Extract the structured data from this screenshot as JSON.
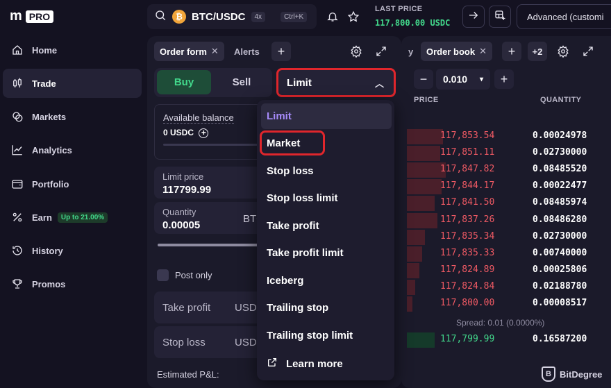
{
  "brand": {
    "logo": "m",
    "badge": "PRO"
  },
  "sidebar": {
    "items": [
      {
        "label": "Home",
        "icon": "home-icon"
      },
      {
        "label": "Trade",
        "icon": "trade-icon",
        "active": true
      },
      {
        "label": "Markets",
        "icon": "markets-icon"
      },
      {
        "label": "Analytics",
        "icon": "analytics-icon"
      },
      {
        "label": "Portfolio",
        "icon": "portfolio-icon"
      },
      {
        "label": "Earn",
        "icon": "percent-icon",
        "badge": "Up to 21.00%"
      },
      {
        "label": "History",
        "icon": "history-icon"
      },
      {
        "label": "Promos",
        "icon": "trophy-icon"
      }
    ]
  },
  "topbar": {
    "coin_symbol": "₿",
    "pair": "BTC/USDC",
    "leverage": "4x",
    "shortcut": "Ctrl+K",
    "last_price_label": "LAST PRICE",
    "last_price": "117,800.00 USDC",
    "layout": "Advanced (customi"
  },
  "order_form": {
    "tabs": [
      "Order form",
      "Alerts"
    ],
    "buy_label": "Buy",
    "sell_label": "Sell",
    "order_type": "Limit",
    "available_balance_label": "Available balance",
    "available_balance_value": "0 USDC",
    "limit_price_label": "Limit price",
    "limit_price_value": "117799.99",
    "quantity_label": "Quantity",
    "quantity_value": "0.00005",
    "quantity_unit": "BTC",
    "post_only_label": "Post only",
    "take_profit_label": "Take profit",
    "take_profit_unit": "USDC",
    "stop_loss_label": "Stop loss",
    "stop_loss_unit": "USDC",
    "estimated_pl_label": "Estimated P&L:"
  },
  "dropdown": {
    "options": [
      "Limit",
      "Market",
      "Stop loss",
      "Stop loss limit",
      "Take profit",
      "Take profit limit",
      "Iceberg",
      "Trailing stop",
      "Trailing stop limit"
    ],
    "learn_more": "Learn more",
    "highlight_color": "#e0262c"
  },
  "order_book": {
    "tab_partial": "y",
    "tab": "Order book",
    "extra_tabs": "+2",
    "tick_size": "0.010",
    "price_header": "PRICE",
    "quantity_header": "QUANTITY",
    "asks": [
      {
        "price": "117,853.54",
        "qty": "0.00024978"
      },
      {
        "price": "117,851.11",
        "qty": "0.02730000"
      },
      {
        "price": "117,847.82",
        "qty": "0.08485520"
      },
      {
        "price": "117,844.17",
        "qty": "0.00022477"
      },
      {
        "price": "117,841.50",
        "qty": "0.08485974"
      },
      {
        "price": "117,837.26",
        "qty": "0.08486280"
      },
      {
        "price": "117,835.34",
        "qty": "0.02730000"
      },
      {
        "price": "117,835.33",
        "qty": "0.00740000"
      },
      {
        "price": "117,824.89",
        "qty": "0.00025806"
      },
      {
        "price": "117,824.84",
        "qty": "0.02188780"
      },
      {
        "price": "117,800.00",
        "qty": "0.00008517"
      }
    ],
    "spread": "Spread: 0.01 (0.0000%)",
    "bids": [
      {
        "price": "117,799.99",
        "qty": "0.16587200"
      }
    ],
    "ask_color": "#f05a64",
    "bid_color": "#42d88b"
  },
  "watermark": {
    "mark": "B",
    "text": "BitDegree"
  }
}
